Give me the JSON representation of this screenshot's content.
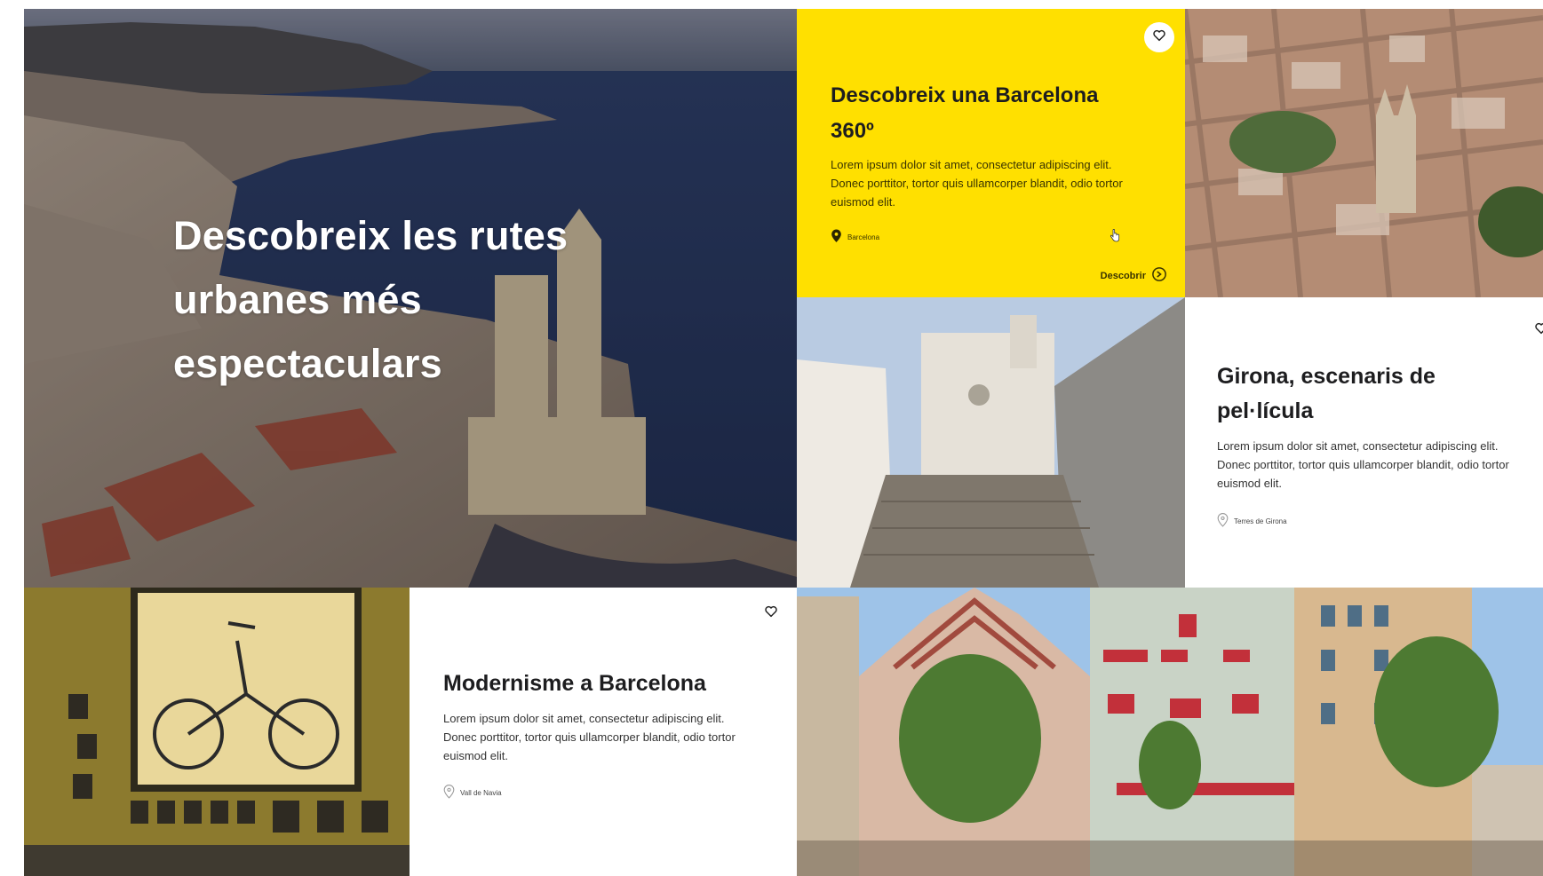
{
  "hero": {
    "title": "Descobreix les rutes urbanes més espectaculars"
  },
  "cards": {
    "barcelona360": {
      "title": "Descobreix una Barcelona 360º",
      "description": "Lorem ipsum dolor sit amet, consectetur adipiscing elit. Donec porttitor, tortor quis ullamcorper blandit, odio tortor euismod elit.",
      "location": "Barcelona",
      "cta": "Descobrir",
      "accent": "#ffe000"
    },
    "girona": {
      "title": "Girona, escenaris de pel·lícula",
      "description": "Lorem ipsum dolor sit amet, consectetur adipiscing elit. Donec porttitor, tortor quis ullamcorper blandit, odio tortor euismod elit.",
      "location": "Terres de Girona"
    },
    "modernisme": {
      "title": "Modernisme a Barcelona",
      "description": "Lorem ipsum dolor sit amet, consectetur adipiscing elit. Donec porttitor, tortor quis ullamcorper blandit, odio tortor euismod elit.",
      "location": "Vall de Navia"
    }
  },
  "icons": {
    "favorite": "heart-icon",
    "location": "map-pin-icon",
    "discover": "arrow-circle-icon",
    "cursor": "hand-pointer-icon"
  }
}
